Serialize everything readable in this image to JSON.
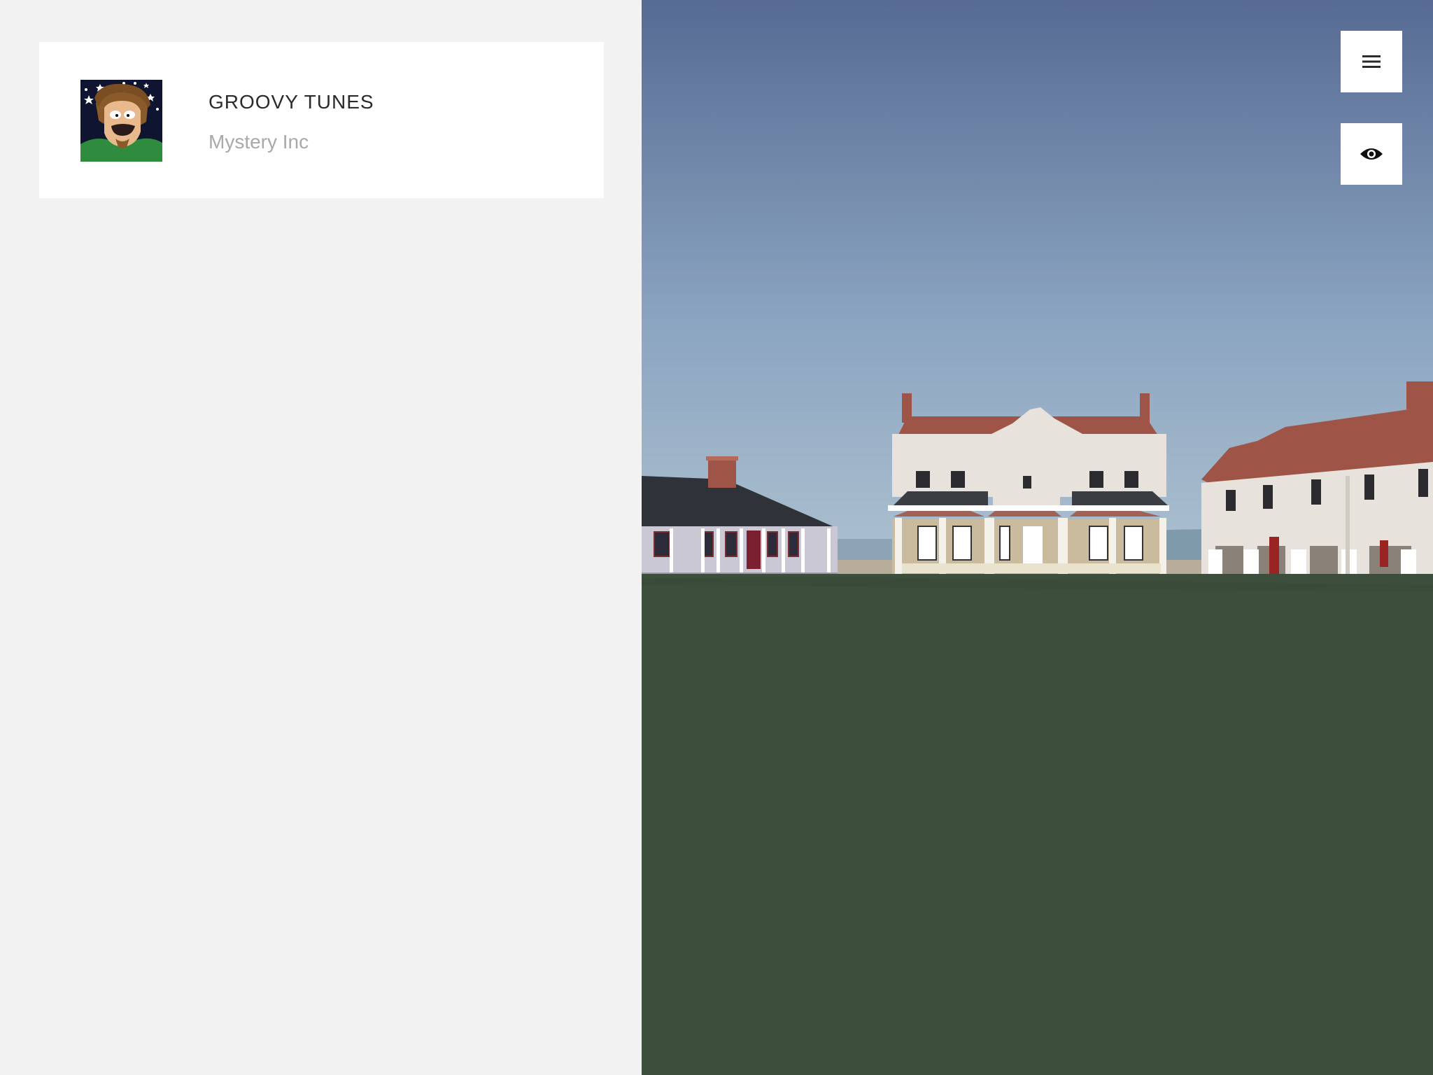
{
  "now_playing": {
    "title": "GROOVY TUNES",
    "artist": "Mystery Inc",
    "cover_icon": "shaggy-cover-art"
  },
  "toolbar": {
    "menu_icon": "hamburger-menu-icon",
    "view_icon": "eye-icon"
  },
  "colors": {
    "panel_bg": "#f2f2f2",
    "card_bg": "#ffffff",
    "title_text": "#2b2b2b",
    "artist_text": "#a9a9a9",
    "sky_top": "#566a93",
    "sky_horizon": "#a6bccd",
    "grass": "#3d4f3c",
    "roof_red": "#9e5547",
    "wall_cream": "#e7e3dc"
  }
}
